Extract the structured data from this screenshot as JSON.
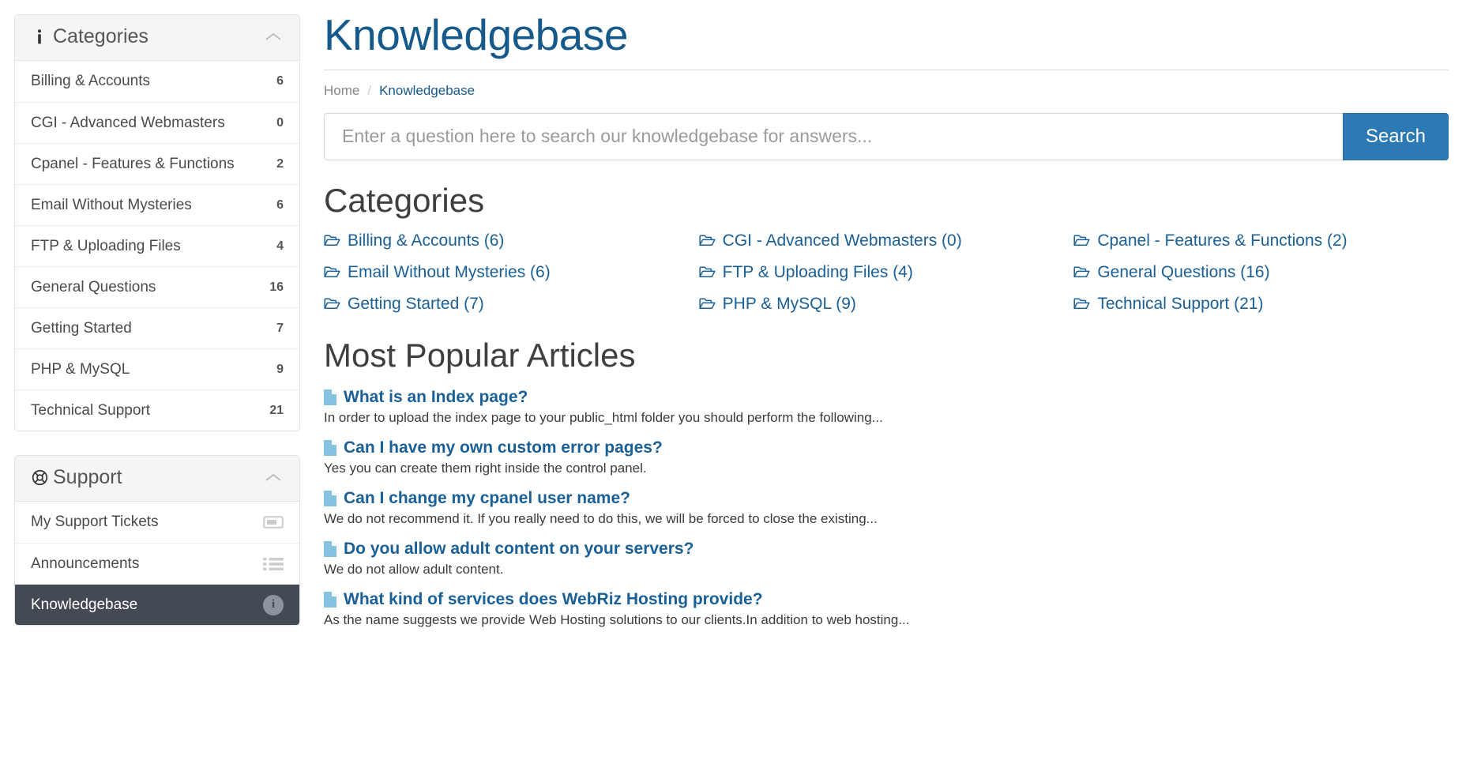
{
  "sidebar": {
    "categories_panel": {
      "icon": "info-icon",
      "title": "Categories",
      "collapse_icon": "chevron-up-icon",
      "items": [
        {
          "label": "Billing & Accounts",
          "count": "6"
        },
        {
          "label": "CGI - Advanced Webmasters",
          "count": "0"
        },
        {
          "label": "Cpanel - Features & Functions",
          "count": "2"
        },
        {
          "label": "Email Without Mysteries",
          "count": "6"
        },
        {
          "label": "FTP & Uploading Files",
          "count": "4"
        },
        {
          "label": "General Questions",
          "count": "16"
        },
        {
          "label": "Getting Started",
          "count": "7"
        },
        {
          "label": "PHP & MySQL",
          "count": "9"
        },
        {
          "label": "Technical Support",
          "count": "21"
        }
      ]
    },
    "support_panel": {
      "icon": "lifebuoy-icon",
      "title": "Support",
      "collapse_icon": "chevron-up-icon",
      "items": [
        {
          "label": "My Support Tickets",
          "icon": "ticket-icon",
          "active": false
        },
        {
          "label": "Announcements",
          "icon": "list-icon",
          "active": false
        },
        {
          "label": "Knowledgebase",
          "icon": "info-circle-icon",
          "active": true
        }
      ]
    }
  },
  "main": {
    "page_title": "Knowledgebase",
    "breadcrumb": {
      "home": "Home",
      "separator": "/",
      "current": "Knowledgebase"
    },
    "search": {
      "placeholder": "Enter a question here to search our knowledgebase for answers...",
      "value": "",
      "button_label": "Search"
    },
    "categories_section": {
      "heading": "Categories",
      "items": [
        {
          "label": "Billing & Accounts (6)",
          "icon": "folder-open-icon"
        },
        {
          "label": "CGI - Advanced Webmasters (0)",
          "icon": "folder-open-icon"
        },
        {
          "label": "Cpanel - Features & Functions (2)",
          "icon": "folder-open-icon"
        },
        {
          "label": "Email Without Mysteries (6)",
          "icon": "folder-open-icon"
        },
        {
          "label": "FTP & Uploading Files (4)",
          "icon": "folder-open-icon"
        },
        {
          "label": "General Questions (16)",
          "icon": "folder-open-icon"
        },
        {
          "label": "Getting Started (7)",
          "icon": "folder-open-icon"
        },
        {
          "label": "PHP & MySQL (9)",
          "icon": "folder-open-icon"
        },
        {
          "label": "Technical Support (21)",
          "icon": "folder-open-icon"
        }
      ]
    },
    "articles_section": {
      "heading": "Most Popular Articles",
      "items": [
        {
          "title": "What is an Index page?",
          "description": "In order to upload the index page to your public_html folder you should perform the following..."
        },
        {
          "title": "Can I have my own custom error pages?",
          "description": "Yes you can create them right inside the control panel."
        },
        {
          "title": "Can I change my cpanel user name?",
          "description": "We do not recommend it. If you really need to do this, we will be forced to close the existing..."
        },
        {
          "title": "Do you allow adult content on your servers?",
          "description": "We do not allow adult content."
        },
        {
          "title": "What kind of services does WebRiz Hosting provide?",
          "description": "As the name suggests we provide Web Hosting solutions to our clients.In addition to web hosting..."
        }
      ]
    }
  },
  "colors": {
    "link": "#1a6096",
    "title": "#155a8a",
    "button": "#2d79b4",
    "active_row": "#434a54",
    "doc_icon": "#85c1e0"
  }
}
